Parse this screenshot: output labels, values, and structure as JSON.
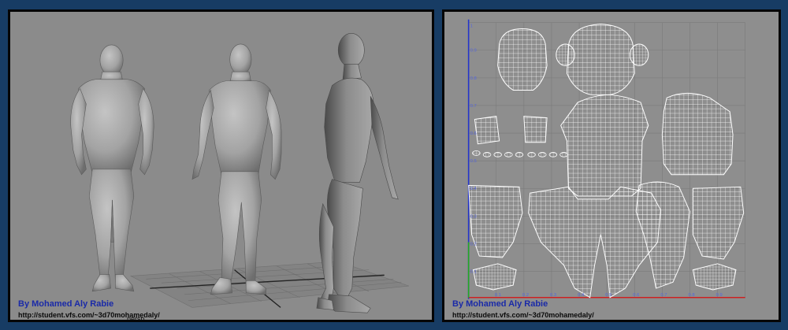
{
  "left_panel": {
    "credit": "By Mohamed Aly Rabie",
    "url": "http://student.vfs.com/~3d70mohamedaly/",
    "view_label": "persp"
  },
  "right_panel": {
    "credit": "By Mohamed Aly Rabie",
    "url": "http://student.vfs.com/~3d70mohamedaly/",
    "y_ticks": [
      "1",
      "0.9",
      "0.8",
      "0.7",
      "0.6",
      "0.5",
      "0.4",
      "0.3",
      "0.2",
      "0.1"
    ],
    "x_ticks": [
      "0.1",
      "0.2",
      "0.3",
      "0.4",
      "0.5",
      "0.6",
      "0.7",
      "0.8",
      "0.9"
    ]
  },
  "colors": {
    "background": "#173c64",
    "frame_border": "#050505",
    "viewport_gray": "#8b8b8b",
    "uv_lines": "#ffffff",
    "uv_axis_x": "#cc2222",
    "uv_axis_y": "#2233cc",
    "credit_blue": "#1a2aa8"
  }
}
